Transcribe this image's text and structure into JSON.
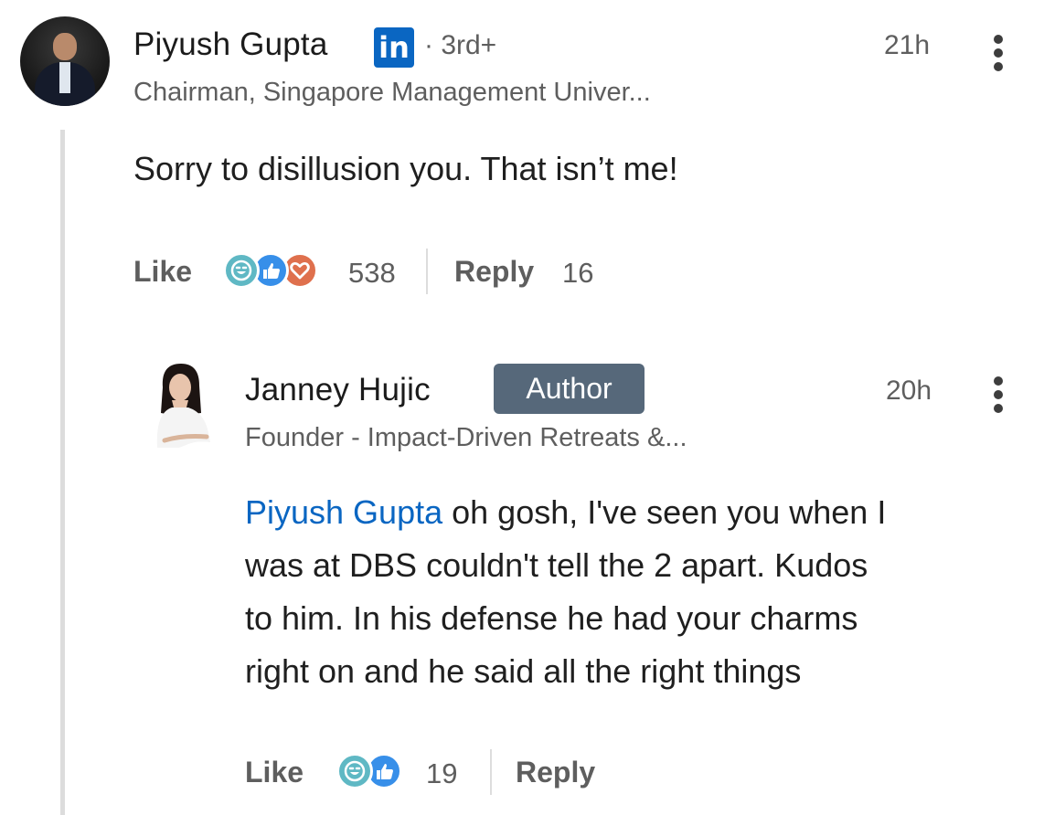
{
  "comment": {
    "author_name": "Piyush Gupta",
    "network_icon": "linkedin-icon",
    "network_icon_text": "in",
    "degree": "· 3rd+",
    "headline": "Chairman, Singapore Management Univer...",
    "time": "21h",
    "text": "Sorry to disillusion you. That isn’t me!",
    "like_label": "Like",
    "reactions": [
      "funny-icon",
      "like-icon",
      "love-icon"
    ],
    "reaction_count": "538",
    "reply_label": "Reply",
    "reply_count": "16"
  },
  "reply": {
    "author_name": "Janney Hujic",
    "badge": "Author",
    "headline": "Founder - Impact-Driven Retreats &...",
    "time": "20h",
    "mention": "Piyush Gupta",
    "text_line1": " oh gosh, I've seen you when I",
    "text_line2": "was at DBS couldn't tell the 2 apart. Kudos",
    "text_line3": "to him. In his defense he had your charms",
    "text_line4": "right on and he said all the right things",
    "like_label": "Like",
    "reactions": [
      "funny-icon",
      "like-icon"
    ],
    "reaction_count": "19",
    "reply_label": "Reply"
  },
  "colors": {
    "mention": "#0a66c2",
    "linkedin": "#0a66c2",
    "author_badge": "#56687a",
    "reaction_funny": "#5fb8c4",
    "reaction_like": "#378fe9",
    "reaction_love": "#df704d"
  }
}
